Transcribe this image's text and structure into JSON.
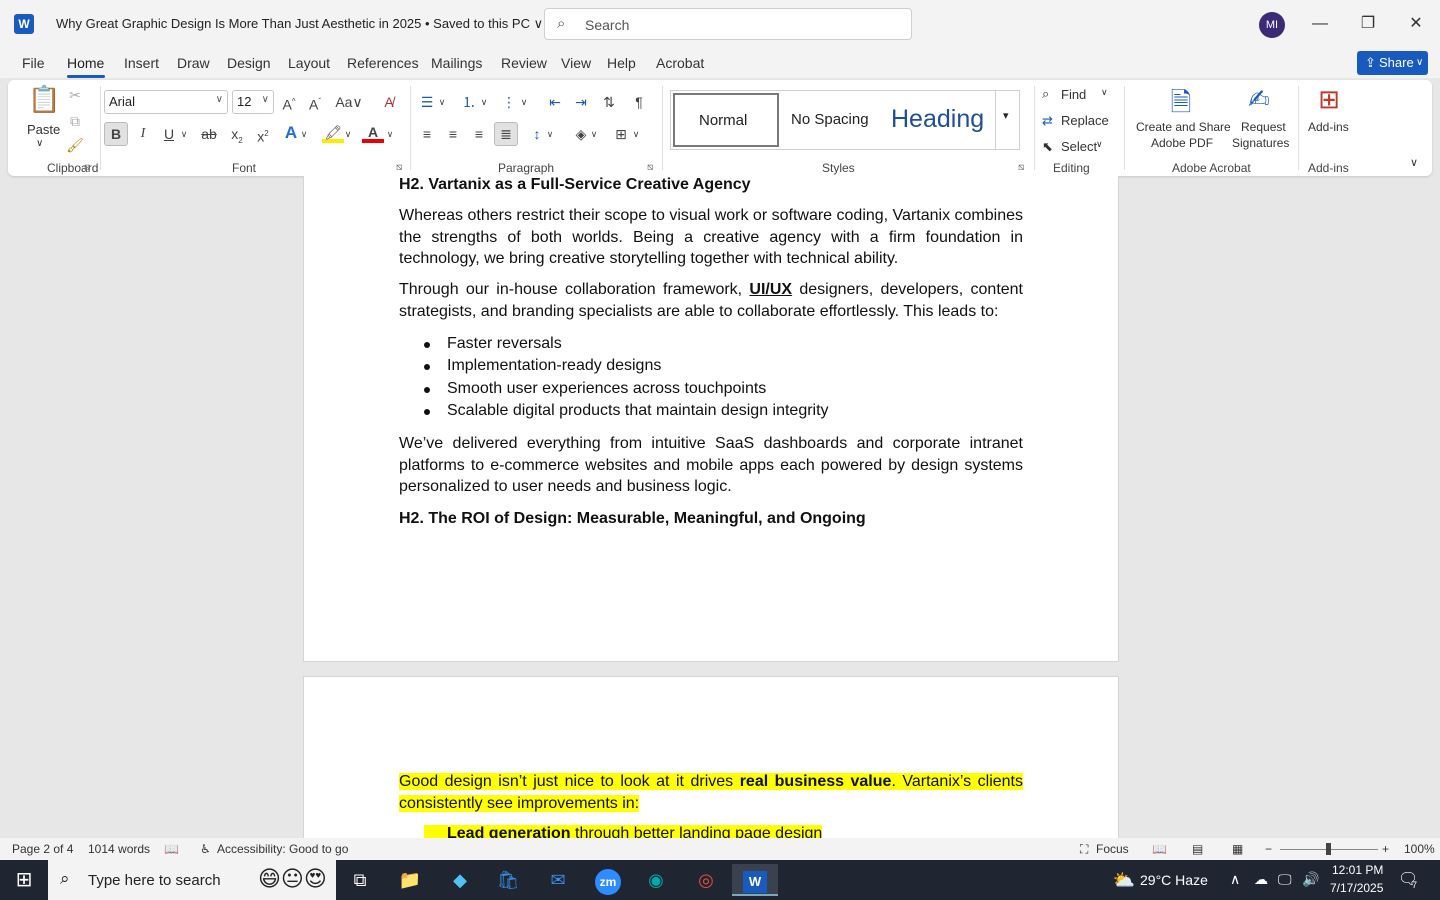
{
  "app": {
    "logo_letter": "W",
    "title": "Why Great Graphic Design Is More Than Just Aesthetic in 2025 • Saved to this PC ∨",
    "search_placeholder": "Search",
    "user_initials": "MI"
  },
  "menu": {
    "tabs": [
      "File",
      "Home",
      "Insert",
      "Draw",
      "Design",
      "Layout",
      "References",
      "Mailings",
      "Review",
      "View",
      "Help",
      "Acrobat"
    ],
    "active": "Home",
    "share_label": "Share"
  },
  "ribbon": {
    "clipboard": {
      "label": "Clipboard",
      "paste": "Paste"
    },
    "font": {
      "label": "Font",
      "family": "Arial",
      "size": "12"
    },
    "paragraph": {
      "label": "Paragraph"
    },
    "styles": {
      "label": "Styles",
      "items": [
        "Normal",
        "No Spacing",
        "Heading"
      ]
    },
    "editing": {
      "label": "Editing",
      "find": "Find",
      "replace": "Replace",
      "select": "Select"
    },
    "acrobat": {
      "label": "Adobe Acrobat",
      "create_share_1": "Create and Share",
      "create_share_2": "Adobe PDF",
      "request_1": "Request",
      "request_2": "Signatures"
    },
    "addins": {
      "label": "Add-ins",
      "addins": "Add-ins"
    }
  },
  "document": {
    "heading1": "H2. Vartanix as a Full-Service Creative Agency",
    "para1": "Whereas others restrict their scope to visual work or software coding, Vartanix combines the strengths of both worlds. Being a creative agency with a firm foundation in technology, we bring creative storytelling together with technical ability.",
    "para2_before": "Through our in-house collaboration framework, ",
    "para2_bold": "UI/UX",
    "para2_after": " designers, developers, content strategists, and branding specialists are able to collaborate effortlessly. This leads to:",
    "bullets": [
      "Faster reversals",
      "Implementation-ready designs",
      "Smooth user experiences across touchpoints",
      "Scalable digital products that maintain design integrity"
    ],
    "para3": "We’ve delivered everything from intuitive SaaS dashboards and corporate intranet platforms to e-commerce websites and mobile apps each powered by design systems personalized to user needs and business logic.",
    "heading2": "H2. The ROI of Design: Measurable, Meaningful, and Ongoing",
    "page2_before": "Good design isn’t just nice to look at it drives ",
    "page2_bold": "real business value",
    "page2_after": ". Vartanix’s clients consistently see improvements in:",
    "page2_bullet_bold": "Lead generation",
    "page2_bullet_rest": " through better landing page design"
  },
  "status": {
    "page": "Page 2 of 4",
    "words": "1014 words",
    "accessibility": "Accessibility: Good to go",
    "focus": "Focus",
    "zoom": "100%"
  },
  "taskbar": {
    "search": "Type here to search",
    "weather": "29°C  Haze",
    "time": "12:01 PM",
    "date": "7/17/2025",
    "notif_count": "7"
  }
}
